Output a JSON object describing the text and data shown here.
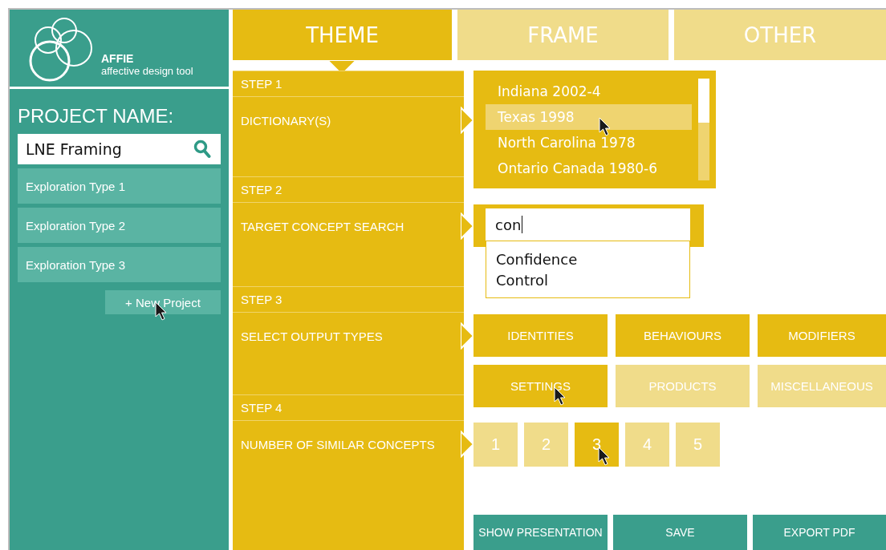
{
  "app": {
    "name": "AFFIE",
    "tagline": "affective design tool"
  },
  "sidebar": {
    "heading": "PROJECT NAME:",
    "project_field": {
      "value": "LNE Framing"
    },
    "items": [
      {
        "label": "Exploration Type 1"
      },
      {
        "label": "Exploration Type 2"
      },
      {
        "label": "Exploration Type 3"
      }
    ],
    "new_button": "+ New Project"
  },
  "tabs": [
    {
      "label": "THEME",
      "selected": true
    },
    {
      "label": "FRAME",
      "selected": false
    },
    {
      "label": "OTHER",
      "selected": false
    }
  ],
  "steps": [
    {
      "step": "STEP 1",
      "title": "DICTIONARY(S)",
      "kind": "list",
      "items": [
        {
          "label": "Indiana 2002-4",
          "selected": false
        },
        {
          "label": "Texas 1998",
          "selected": true
        },
        {
          "label": "North Carolina 1978",
          "selected": false
        },
        {
          "label": "Ontario Canada 1980-6",
          "selected": false
        }
      ]
    },
    {
      "step": "STEP 2",
      "title": "TARGET CONCEPT SEARCH",
      "kind": "search",
      "value": "con",
      "suggestions": [
        "Confidence",
        "Control"
      ]
    },
    {
      "step": "STEP 3",
      "title": "SELECT OUTPUT TYPES",
      "kind": "options",
      "options": [
        {
          "label": "IDENTITIES",
          "selected": true
        },
        {
          "label": "BEHAVIOURS",
          "selected": true
        },
        {
          "label": "MODIFIERS",
          "selected": true
        },
        {
          "label": "SETTINGS",
          "selected": true
        },
        {
          "label": "PRODUCTS",
          "selected": false
        },
        {
          "label": "MISCELLANEOUS",
          "selected": false
        }
      ]
    },
    {
      "step": "STEP 4",
      "title": "NUMBER OF SIMILAR CONCEPTS",
      "kind": "numbers",
      "options": [
        {
          "label": "1",
          "selected": false
        },
        {
          "label": "2",
          "selected": false
        },
        {
          "label": "3",
          "selected": true
        },
        {
          "label": "4",
          "selected": false
        },
        {
          "label": "5",
          "selected": false
        }
      ]
    }
  ],
  "actions": [
    "SHOW PRESENTATION",
    "SAVE",
    "EXPORT PDF"
  ]
}
